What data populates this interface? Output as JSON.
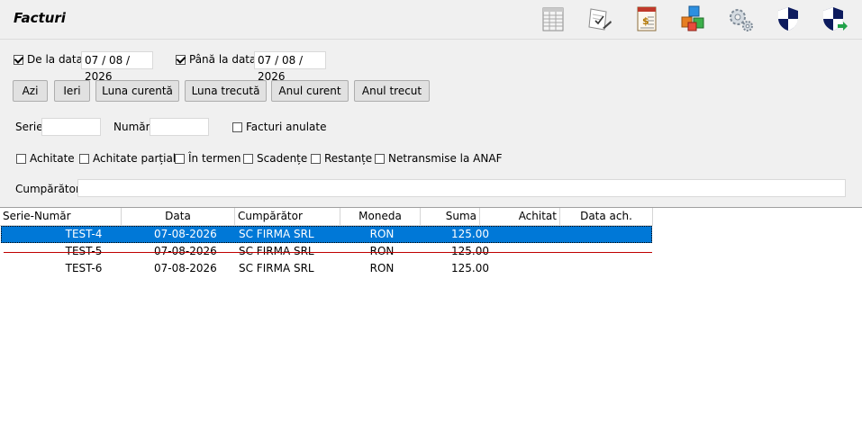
{
  "header": {
    "title": "Facturi",
    "toolbar": [
      {
        "name": "list-report-icon",
        "color": "#cfcfcf"
      },
      {
        "name": "edit-document-icon",
        "color": "#e8e8e8"
      },
      {
        "name": "invoice-dollar-icon",
        "color": "#c0392b"
      },
      {
        "name": "cubes-icon",
        "color": "#3aa0e6"
      },
      {
        "name": "settings-gears-icon",
        "color": "#9aa6b2"
      },
      {
        "name": "shield-icon",
        "color": "#0d1b5e"
      },
      {
        "name": "shield-export-icon",
        "color": "#0d1b5e"
      }
    ]
  },
  "filters": {
    "from_label": "De la data",
    "from_value": "07 / 08 / 2026",
    "from_checked": true,
    "to_label": "Până la data",
    "to_value": "07 / 08 / 2026",
    "to_checked": true,
    "quick_buttons": [
      "Azi",
      "Ieri",
      "Luna curentă",
      "Luna trecută",
      "Anul curent",
      "Anul trecut"
    ],
    "serie_label": "Serie",
    "serie_value": "",
    "numar_label": "Număr",
    "numar_value": "",
    "anulate_label": "Facturi anulate",
    "status_checks": [
      "Achitate",
      "Achitate parțial",
      "În termen",
      "Scadențe",
      "Restanțe",
      "Netransmise la ANAF"
    ],
    "cumparator_label": "Cumpărător",
    "cumparator_value": ""
  },
  "table": {
    "columns": [
      "Serie-Număr",
      "Data",
      "Cumpărător",
      "Moneda",
      "Suma",
      "Achitat",
      "Data ach."
    ],
    "rows": [
      {
        "serie": "TEST-4",
        "data": "07-08-2026",
        "cumparator": "SC FIRMA SRL",
        "moneda": "RON",
        "suma": "125.00",
        "achitat": "",
        "data_ach": "",
        "selected": true,
        "cancelled": false
      },
      {
        "serie": "TEST-5",
        "data": "07-08-2026",
        "cumparator": "SC FIRMA SRL",
        "moneda": "RON",
        "suma": "125.00",
        "achitat": "",
        "data_ach": "",
        "selected": false,
        "cancelled": true
      },
      {
        "serie": "TEST-6",
        "data": "07-08-2026",
        "cumparator": "SC FIRMA SRL",
        "moneda": "RON",
        "suma": "125.00",
        "achitat": "",
        "data_ach": "",
        "selected": false,
        "cancelled": false
      }
    ],
    "selected_color": "#0078d7",
    "cancelled_line_color": "#c00000"
  }
}
